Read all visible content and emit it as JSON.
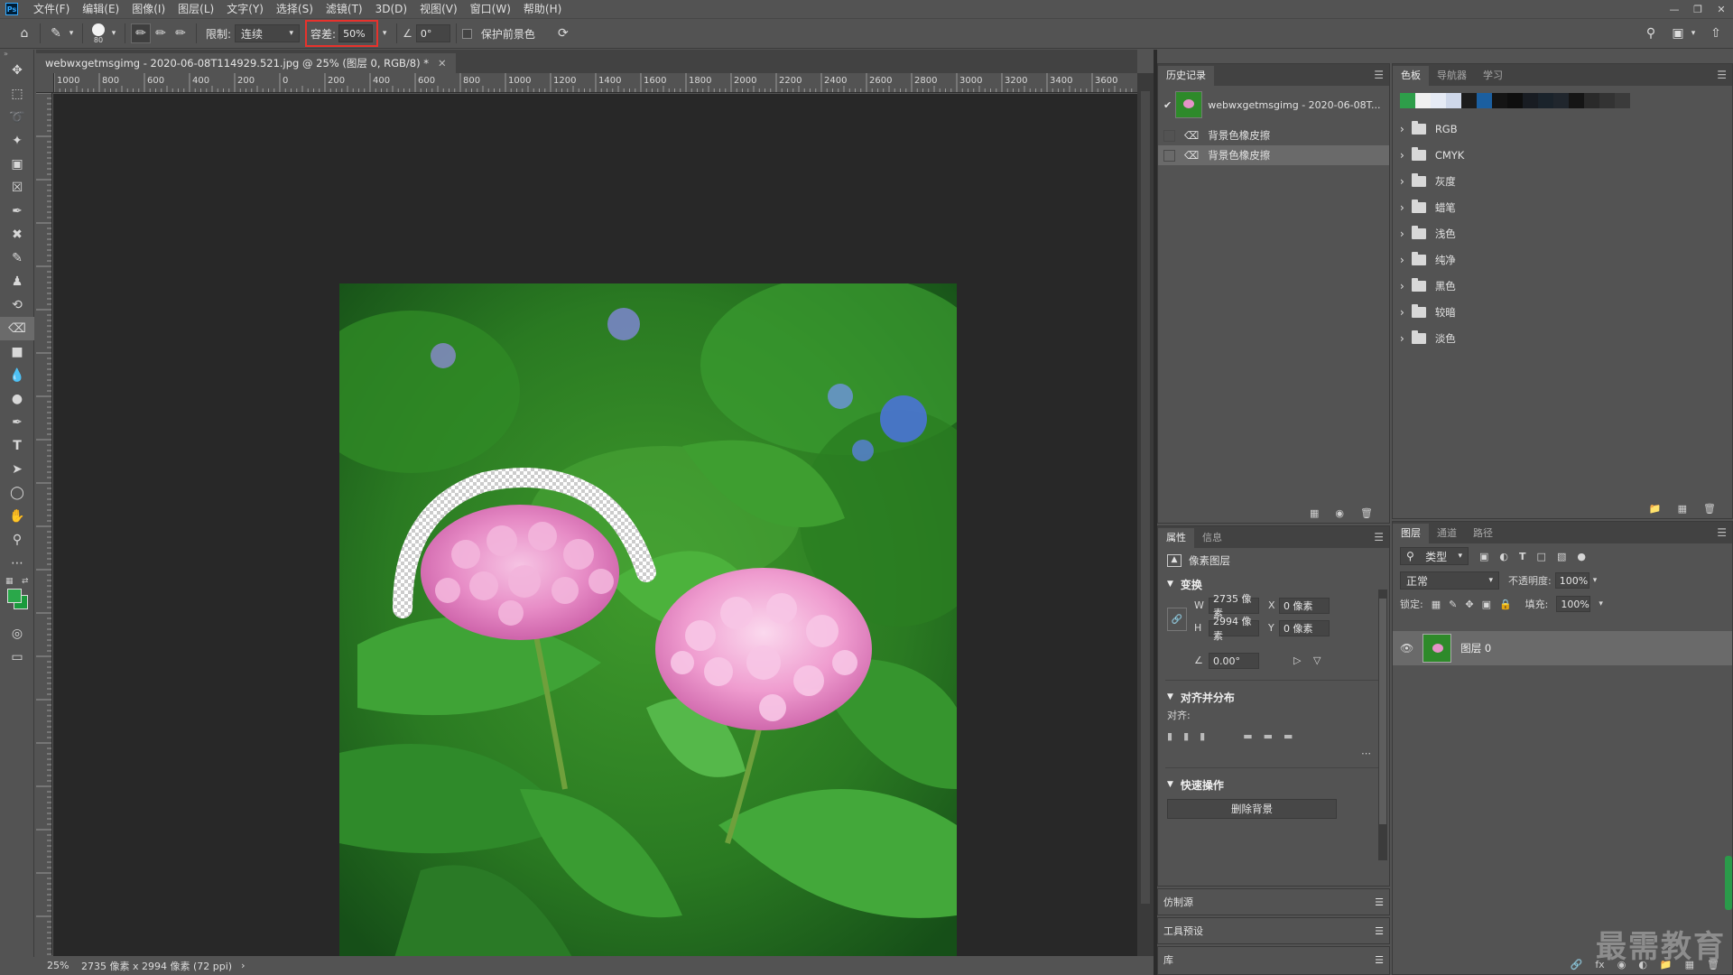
{
  "menu": {
    "logo": "Ps",
    "items": [
      "文件(F)",
      "编辑(E)",
      "图像(I)",
      "图层(L)",
      "文字(Y)",
      "选择(S)",
      "滤镜(T)",
      "3D(D)",
      "视图(V)",
      "窗口(W)",
      "帮助(H)"
    ]
  },
  "options": {
    "brush_size": "80",
    "limit_label": "限制:",
    "limit_value": "连续",
    "tolerance_label": "容差:",
    "tolerance_value": "50%",
    "angle_value": "0°",
    "protect_label": "保护前景色"
  },
  "document": {
    "tab_title": "webwxgetmsgimg - 2020-06-08T114929.521.jpg @ 25% (图层 0, RGB/8) *",
    "hruler_labels": [
      "1000",
      "800",
      "600",
      "400",
      "200",
      "0",
      "200",
      "400",
      "600",
      "800",
      "1000",
      "1200",
      "1400",
      "1600",
      "1800",
      "2000",
      "2200",
      "2400",
      "2600",
      "2800",
      "3000",
      "3200",
      "3400",
      "3600"
    ],
    "status_zoom": "25%",
    "status_info": "2735 像素 x 2994 像素 (72 ppi)"
  },
  "history": {
    "tab": "历史记录",
    "snapshot": "webwxgetmsgimg - 2020-06-08T...",
    "rows": [
      "背景色橡皮擦",
      "背景色橡皮擦"
    ]
  },
  "swatches": {
    "tabs": [
      "色板",
      "导航器",
      "学习"
    ],
    "colors": [
      "#2e9e4a",
      "#f0f0f0",
      "#e6ebf5",
      "#cfd8ea",
      "#1c1c1c",
      "#1b5fa0",
      "#141414",
      "#0e0e0e",
      "#181c22",
      "#1a232b",
      "#20262d",
      "#151515",
      "#2a2a2a",
      "#333333",
      "#3b3b3b"
    ],
    "groups": [
      "RGB",
      "CMYK",
      "灰度",
      "蜡笔",
      "浅色",
      "纯净",
      "黑色",
      "较暗",
      "淡色"
    ]
  },
  "properties": {
    "tabs": [
      "属性",
      "信息"
    ],
    "kind": "像素图层",
    "transform_head": "变换",
    "w_label": "W",
    "w_value": "2735 像素",
    "x_label": "X",
    "x_value": "0 像素",
    "h_label": "H",
    "h_value": "2994 像素",
    "y_label": "Y",
    "y_value": "0 像素",
    "angle_value": "0.00°",
    "align_head": "对齐并分布",
    "align_label": "对齐:",
    "quick_head": "快速操作",
    "remove_bg": "删除背景"
  },
  "collapsed_panels": [
    "仿制源",
    "工具预设",
    "库"
  ],
  "layers": {
    "tabs": [
      "图层",
      "通道",
      "路径"
    ],
    "filter_label": "类型",
    "blend_mode": "正常",
    "opacity_label": "不透明度:",
    "opacity_value": "100%",
    "lock_label": "锁定:",
    "fill_label": "填充:",
    "fill_value": "100%",
    "layer_name": "图层 0"
  },
  "watermark": "最需教育"
}
